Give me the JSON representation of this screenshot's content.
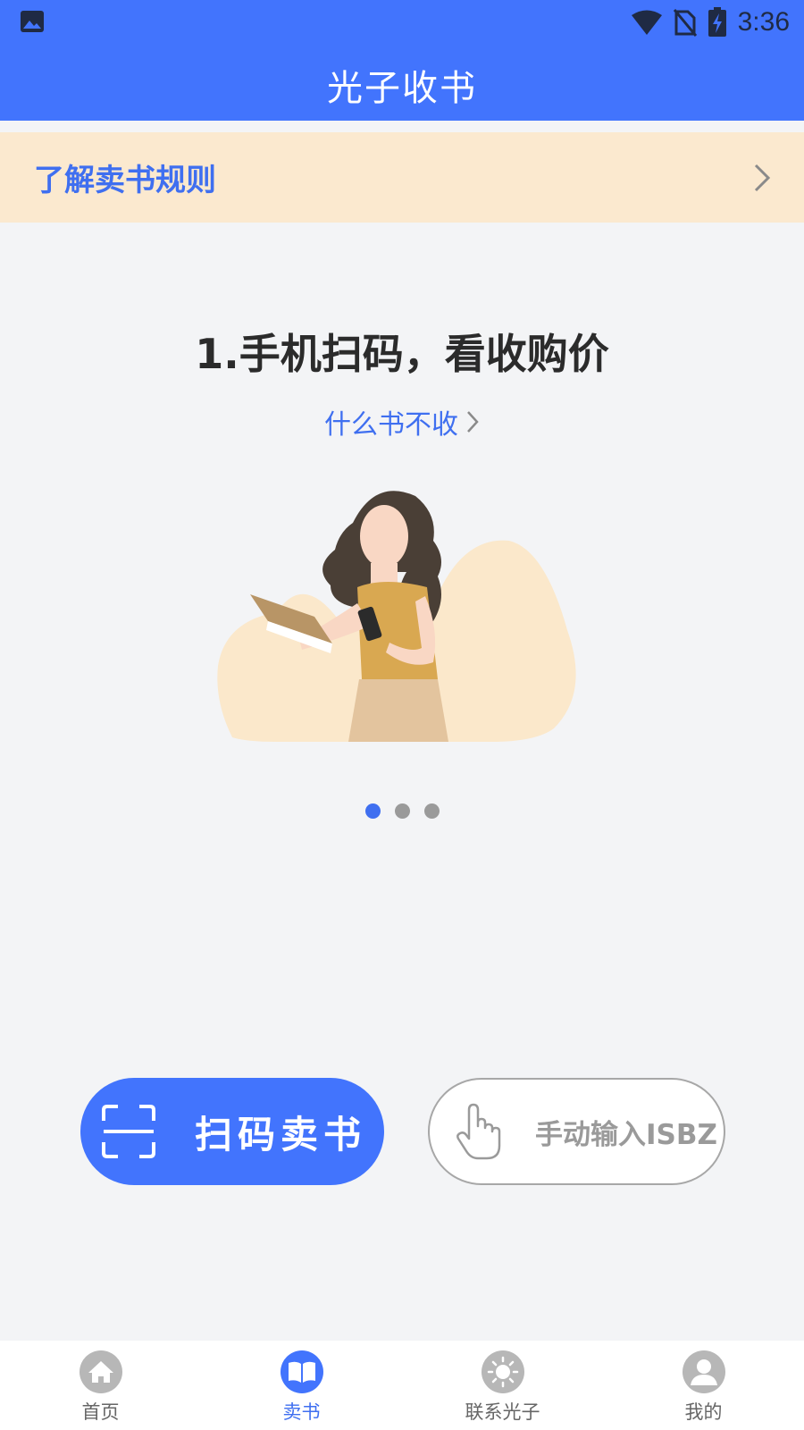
{
  "status_bar": {
    "time": "3:36"
  },
  "header": {
    "title": "光子收书"
  },
  "rules_banner": {
    "label": "了解卖书规则"
  },
  "step": {
    "title": "1.手机扫码，看收购价",
    "link": "什么书不收"
  },
  "carousel": {
    "total": 3,
    "active_index": 0
  },
  "actions": {
    "scan_label": "扫码卖书",
    "manual_label": "手动输入ISBZ"
  },
  "tabs": [
    {
      "label": "首页",
      "icon": "home-icon",
      "active": false
    },
    {
      "label": "卖书",
      "icon": "book-icon",
      "active": true
    },
    {
      "label": "联系光子",
      "icon": "sun-icon",
      "active": false
    },
    {
      "label": "我的",
      "icon": "user-icon",
      "active": false
    }
  ],
  "colors": {
    "primary": "#4274fd",
    "banner_bg": "#fbe9cf",
    "page_bg": "#f3f4f6",
    "tab_inactive_icon": "#b7b7b7"
  }
}
